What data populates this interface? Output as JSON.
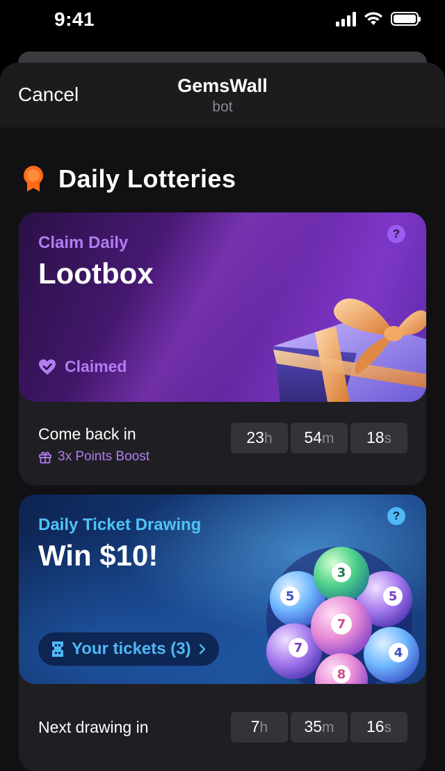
{
  "status_bar": {
    "time": "9:41"
  },
  "header": {
    "cancel_label": "Cancel",
    "title": "GemsWall",
    "subtitle": "bot"
  },
  "section": {
    "title": "Daily Lotteries",
    "icon": "award-icon",
    "icon_color": "#ff6a1a"
  },
  "lootbox_card": {
    "eyebrow": "Claim Daily",
    "headline": "Lootbox",
    "help_label": "?",
    "status": "Claimed",
    "countdown_label": "Come back in",
    "boost_label": "3x Points Boost",
    "timer": {
      "hours": "23",
      "hours_unit": "h",
      "minutes": "54",
      "minutes_unit": "m",
      "seconds": "18",
      "seconds_unit": "s"
    },
    "accent": "#b27cf2"
  },
  "drawing_card": {
    "eyebrow": "Daily Ticket Drawing",
    "headline": "Win $10!",
    "help_label": "?",
    "tickets_label": "Your tickets (3)",
    "countdown_label": "Next drawing in",
    "timer": {
      "hours": "7",
      "hours_unit": "h",
      "minutes": "35",
      "minutes_unit": "m",
      "seconds": "16",
      "seconds_unit": "s"
    },
    "balls": [
      "3",
      "5",
      "5",
      "7",
      "7",
      "4",
      "8"
    ],
    "accent": "#4fb8f5"
  }
}
